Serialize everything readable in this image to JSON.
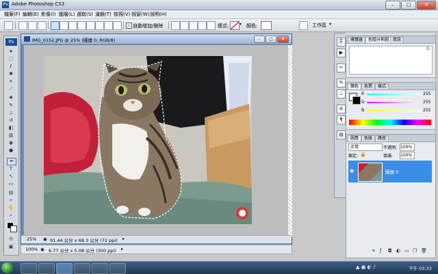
{
  "window": {
    "title": "Adobe Photoshop CS3",
    "app_icon": "Ps",
    "controls": [
      "minimize",
      "maximize",
      "close"
    ]
  },
  "menu": {
    "items": [
      "檔案(F)",
      "編輯(E)",
      "影像(I)",
      "圖層(L)",
      "選取(S)",
      "濾鏡(T)",
      "檢視(V)",
      "視窗(W)",
      "說明(H)"
    ]
  },
  "options_bar": {
    "auto_enhance_label": "自動增加/刪除",
    "auto_enhance_checked": true,
    "style_label": "樣式:",
    "color_label": "顏色:",
    "workspace_label": "工作區"
  },
  "document": {
    "title": "IMG_0152.JPG @ 25% (圖層 0, RGB/8)",
    "zoom": "25%",
    "size_info": "91.44 公分 x 68.3 公分 (72 ppi)"
  },
  "bottom_status": {
    "zoom": "100%",
    "size_info": "6.77 公分 x 5.08 公分 (300 ppi)"
  },
  "panels": {
    "navigator_tabs": [
      "導覽器",
      "色階分佈圖",
      "資訊"
    ],
    "color_tabs": [
      "顏色",
      "色票",
      "樣式"
    ],
    "color_values": {
      "r_label": "R",
      "r": "255",
      "g_label": "G",
      "g": "255",
      "b_label": "B",
      "b": "255"
    },
    "layers_tabs": [
      "圖層",
      "色版",
      "路徑"
    ],
    "blend_mode": "正常",
    "opacity_label": "不透明:",
    "opacity": "100%",
    "lock_label": "鎖定:",
    "fill_label": "填滿:",
    "fill": "100%",
    "layer_name": "圖層 0"
  },
  "taskbar": {
    "time": "下午 03:33"
  },
  "colors": {
    "accent": "#3a7bd5",
    "layer_selected": "#3a8ee6",
    "title_gradient_top": "#dfe6ee"
  }
}
